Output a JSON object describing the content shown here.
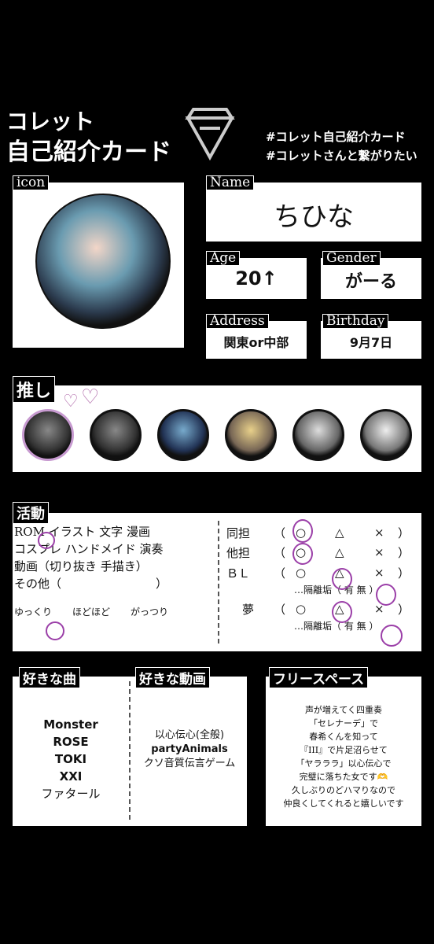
{
  "header": {
    "title_line1": "コレット",
    "title_line2": "自己紹介カード",
    "hashtag1": "#コレット自己紹介カード",
    "hashtag2": "#コレットさんと繋がりたい"
  },
  "icon_section": {
    "label": "icon"
  },
  "name_section": {
    "label": "Name",
    "value": "ちひな"
  },
  "age_section": {
    "label": "Age",
    "value": "20↑"
  },
  "gender_section": {
    "label": "Gender",
    "value": "がーる"
  },
  "address_section": {
    "label": "Address",
    "value": "関東or中部"
  },
  "birthday_section": {
    "label": "Birthday",
    "value": "9月7日"
  },
  "oshi_section": {
    "label": "推し",
    "count": 6
  },
  "katsudo": {
    "label": "活動",
    "row1": "ROM イラスト 文字 漫画",
    "row2": "コスプレ ハンドメイド 演奏",
    "row3": "動画（切り抜き 手描き）",
    "row4": "その他（　　　　　　　　）",
    "freq": [
      "ゆっくり",
      "ほどほど",
      "がっつり"
    ],
    "dotan_label": "同担",
    "tatan_label": "他担",
    "bl_label": "ＢＬ",
    "yume_label": "夢",
    "marks": [
      "（",
      "○",
      "△",
      "×",
      "）"
    ],
    "kakuri1": "…隔離垢（ 有 無 ）",
    "kakuri2": "…隔離垢（ 有 無 ）"
  },
  "songs": {
    "label": "好きな曲",
    "items": [
      "Monster",
      "ROSE",
      "TOKI",
      "XXI",
      "ファタール"
    ]
  },
  "videos": {
    "label": "好きな動画",
    "items": [
      "以心伝心(全般)",
      "partyAnimals",
      "クソ音質伝言ゲーム"
    ]
  },
  "free": {
    "label": "フリースペース",
    "lines": [
      "声が増えてく四重奏",
      "「セレナーデ」で",
      "春希くんを知って",
      "『III』で片足沼らせて",
      "「ヤラララ」以心伝心で",
      "完璧に落ちた女です🫶",
      "久しぶりのどハマりなので",
      "仲良くしてくれると嬉しいです"
    ]
  }
}
